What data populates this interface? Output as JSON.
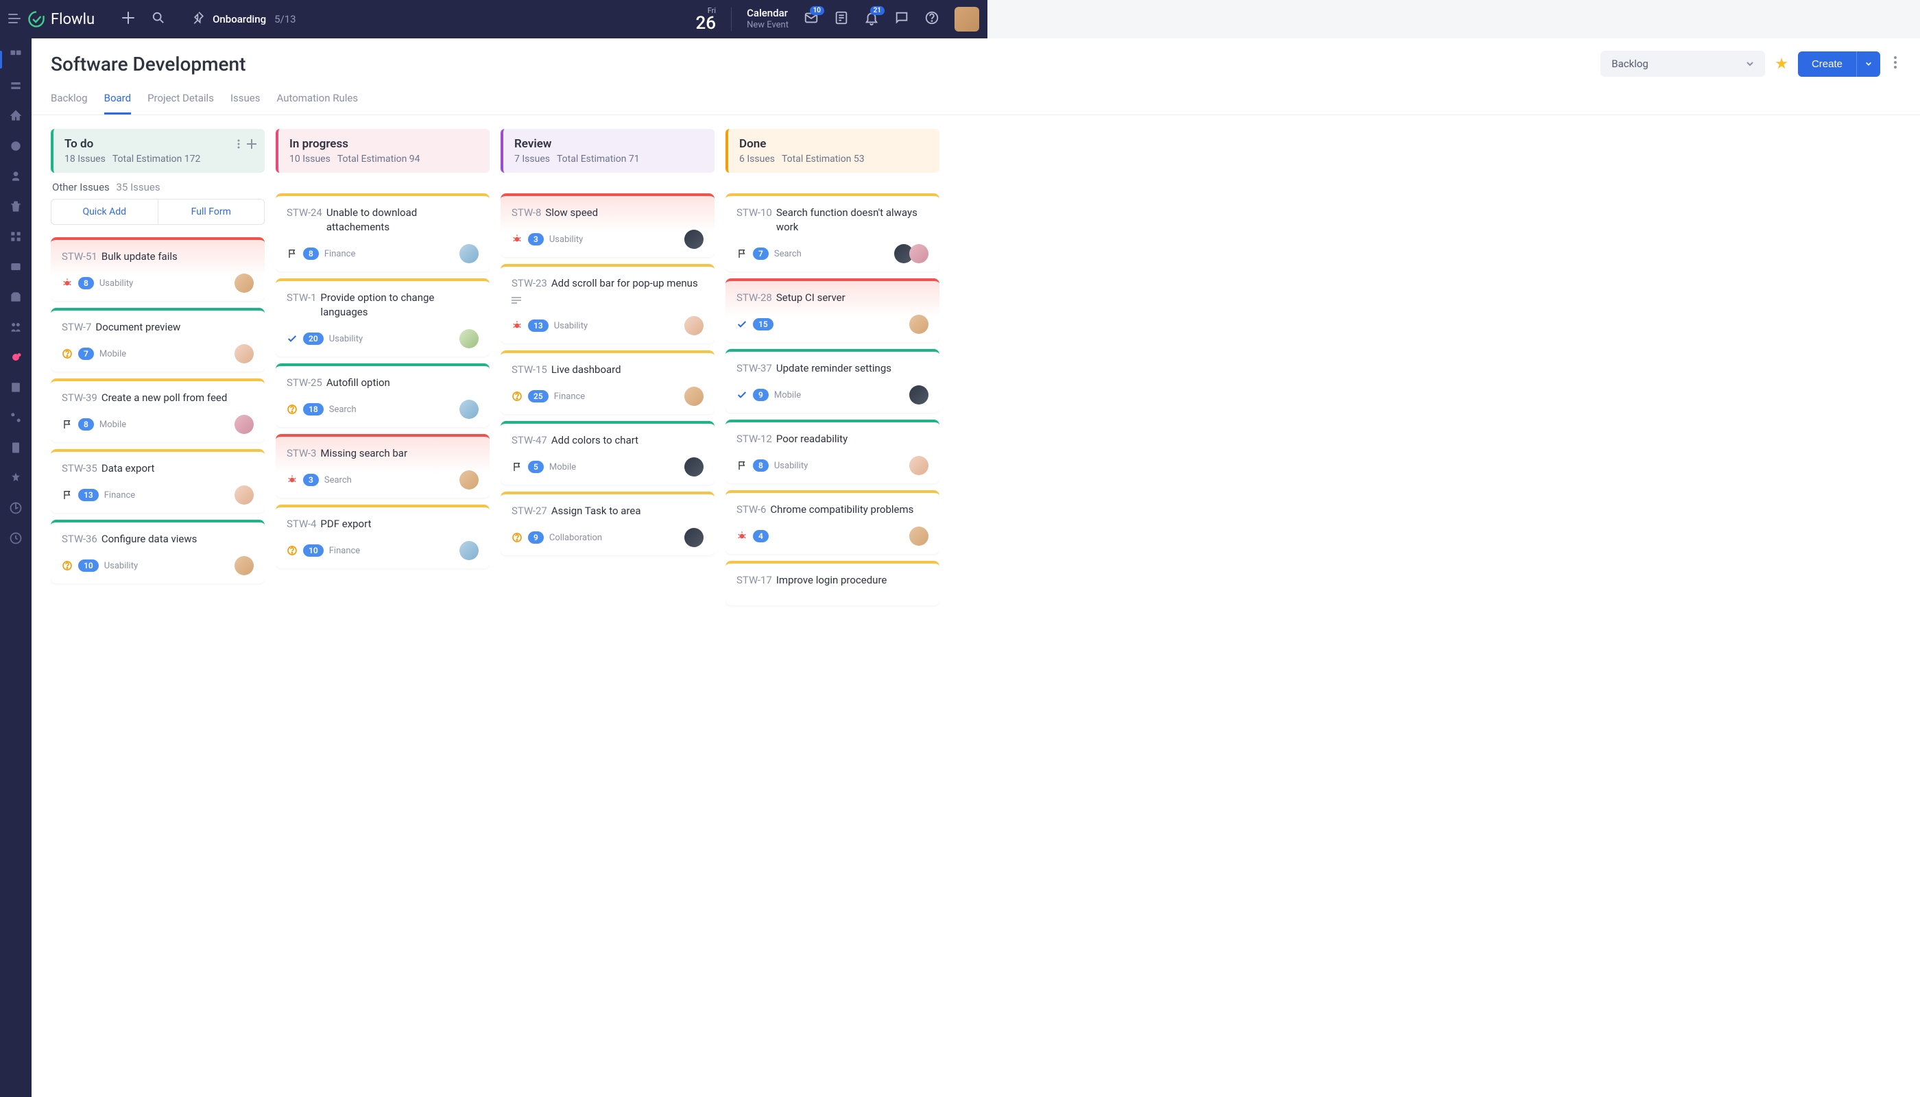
{
  "brand": "Flowlu",
  "onboarding": {
    "label": "Onboarding",
    "progress": "5/13"
  },
  "date": {
    "dayName": "Fri",
    "dayNum": "26"
  },
  "calendar": {
    "title": "Calendar",
    "subtitle": "New Event"
  },
  "badges": {
    "mail": "10",
    "bell": "21"
  },
  "page": {
    "title": "Software Development"
  },
  "backlogSelect": "Backlog",
  "createBtn": "Create",
  "tabs": [
    "Backlog",
    "Board",
    "Project Details",
    "Issues",
    "Automation Rules"
  ],
  "activeTab": 1,
  "otherIssues": {
    "label": "Other Issues",
    "count": "35 Issues"
  },
  "quickAdd": "Quick Add",
  "fullForm": "Full Form",
  "columns": [
    {
      "key": "todo",
      "title": "To do",
      "issues": "18 Issues",
      "est": "Total Estimation 172",
      "cls": "col-todo",
      "showOther": true,
      "showActions": true,
      "cards": [
        {
          "id": "STW-51",
          "title": "Bulk update fails",
          "color": "red",
          "icon": "bug",
          "count": "8",
          "tag": "Usability",
          "av": "av1"
        },
        {
          "id": "STW-7",
          "title": "Document preview",
          "color": "green",
          "icon": "q",
          "count": "7",
          "tag": "Mobile",
          "av": "av2"
        },
        {
          "id": "STW-39",
          "title": "Create a new poll from feed",
          "color": "yellow",
          "icon": "flag",
          "count": "8",
          "tag": "Mobile",
          "av": "av6"
        },
        {
          "id": "STW-35",
          "title": "Data export",
          "color": "yellow",
          "icon": "flag",
          "count": "13",
          "tag": "Finance",
          "av": "av2"
        },
        {
          "id": "STW-36",
          "title": "Configure data views",
          "color": "green",
          "icon": "q",
          "count": "10",
          "tag": "Usability",
          "av": "av1"
        }
      ]
    },
    {
      "key": "progress",
      "title": "In progress",
      "issues": "10 Issues",
      "est": "Total Estimation 94",
      "cls": "col-progress",
      "cards": [
        {
          "id": "STW-24",
          "title": "Unable to download attachements",
          "color": "yellow",
          "icon": "flag",
          "count": "8",
          "tag": "Finance",
          "av": "av4"
        },
        {
          "id": "STW-1",
          "title": "Provide option to change languages",
          "color": "yellow",
          "icon": "check",
          "count": "20",
          "tag": "Usability",
          "av": "av5"
        },
        {
          "id": "STW-25",
          "title": "Autofill option",
          "color": "green",
          "icon": "q",
          "count": "18",
          "tag": "Search",
          "av": "av4"
        },
        {
          "id": "STW-3",
          "title": "Missing search bar",
          "color": "red",
          "icon": "bug",
          "count": "3",
          "tag": "Search",
          "av": "av1"
        },
        {
          "id": "STW-4",
          "title": "PDF export",
          "color": "yellow",
          "icon": "q",
          "count": "10",
          "tag": "Finance",
          "av": "av4"
        }
      ]
    },
    {
      "key": "review",
      "title": "Review",
      "issues": "7 Issues",
      "est": "Total Estimation 71",
      "cls": "col-review",
      "cards": [
        {
          "id": "STW-8",
          "title": "Slow speed",
          "color": "red",
          "icon": "bug",
          "count": "3",
          "tag": "Usability",
          "av": "av7"
        },
        {
          "id": "STW-23",
          "title": "Add scroll bar for pop-up menus",
          "color": "yellow",
          "icon": "bug",
          "count": "13",
          "tag": "Usability",
          "av": "av2",
          "desc": true
        },
        {
          "id": "STW-15",
          "title": "Live dashboard",
          "color": "yellow",
          "icon": "q",
          "count": "25",
          "tag": "Finance",
          "av": "av1"
        },
        {
          "id": "STW-47",
          "title": "Add colors to chart",
          "color": "green",
          "icon": "flag",
          "count": "5",
          "tag": "Mobile",
          "av": "av7"
        },
        {
          "id": "STW-27",
          "title": "Assign Task to area",
          "color": "yellow",
          "icon": "q",
          "count": "9",
          "tag": "Collaboration",
          "av": "av7"
        }
      ]
    },
    {
      "key": "done",
      "title": "Done",
      "issues": "6 Issues",
      "est": "Total Estimation 53",
      "cls": "col-done",
      "cards": [
        {
          "id": "STW-10",
          "title": "Search function doesn't always work",
          "color": "yellow",
          "icon": "flag",
          "count": "7",
          "tag": "Search",
          "av": "av7",
          "av2": "av6"
        },
        {
          "id": "STW-28",
          "title": "Setup CI server",
          "color": "red",
          "icon": "check",
          "count": "15",
          "tag": "",
          "av": "av1"
        },
        {
          "id": "STW-37",
          "title": "Update reminder settings",
          "color": "green",
          "icon": "check",
          "count": "9",
          "tag": "Mobile",
          "av": "av7"
        },
        {
          "id": "STW-12",
          "title": "Poor readability",
          "color": "green",
          "icon": "flag",
          "count": "8",
          "tag": "Usability",
          "av": "av2"
        },
        {
          "id": "STW-6",
          "title": "Chrome compatibility problems",
          "color": "yellow",
          "icon": "bug",
          "count": "4",
          "tag": "",
          "av": "av1"
        },
        {
          "id": "STW-17",
          "title": "Improve login procedure",
          "color": "yellow",
          "icon": "",
          "count": "",
          "tag": "",
          "av": ""
        }
      ]
    }
  ]
}
